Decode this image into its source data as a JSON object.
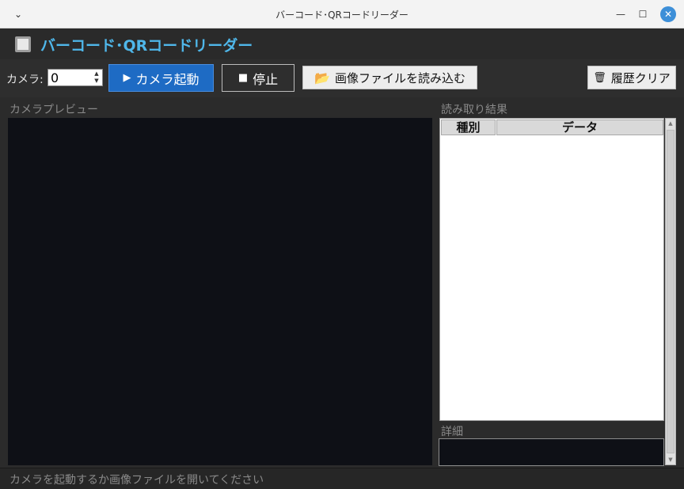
{
  "window": {
    "title": "バーコード･QRコードリーダー",
    "menu_glyph": "⌄",
    "minimize_glyph": "—",
    "maximize_glyph": "☐",
    "close_glyph": "✕"
  },
  "header": {
    "app_title": "バーコード･QRコードリーダー",
    "title_color": "#4fb7ea"
  },
  "toolbar": {
    "camera_label": "カメラ:",
    "camera_value": "0",
    "start_icon": "▶",
    "start_label": "カメラ起動",
    "stop_icon": "■",
    "stop_label": "停止",
    "file_icon": "📂",
    "file_label": "画像ファイルを読み込む",
    "clear_icon": "🗑",
    "clear_label": "履歴クリア",
    "accent_color": "#1e6bc4"
  },
  "preview": {
    "label": "カメラプレビュー"
  },
  "results": {
    "label": "読み取り結果",
    "columns": [
      "種別",
      "データ"
    ],
    "rows": []
  },
  "detail": {
    "label": "詳細",
    "value": ""
  },
  "status": {
    "text": "カメラを起動するか画像ファイルを開いてください"
  }
}
